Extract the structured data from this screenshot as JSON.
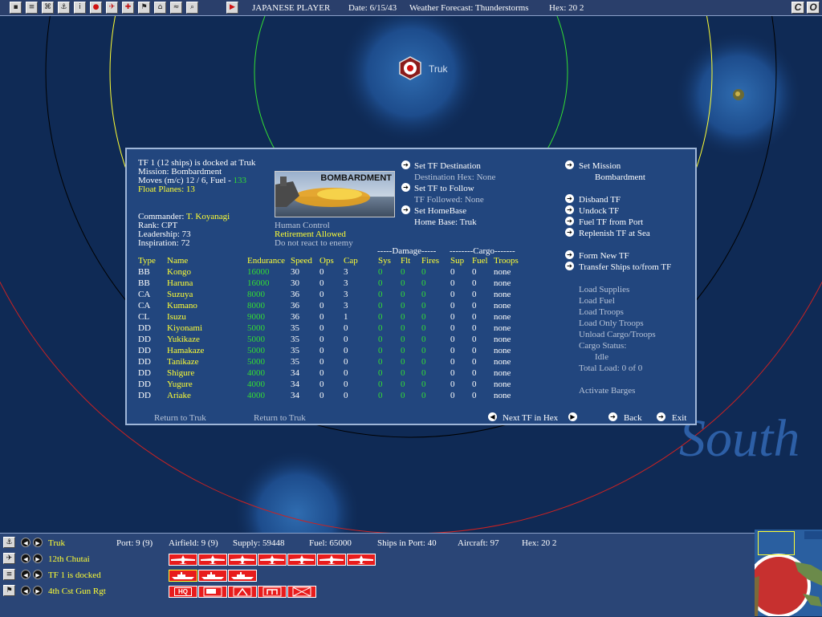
{
  "toolbar": {
    "player": "JAPANESE PLAYER",
    "date": "Date:  6/15/43",
    "weather": "Weather Forecast: Thunderstorms",
    "hex": "Hex: 20 2",
    "btn_c": "C",
    "btn_o": "O"
  },
  "map": {
    "base_label": "Truk",
    "region_label": "South"
  },
  "tf": {
    "header": "TF 1 (12 ships) is docked at Truk",
    "mission": "Mission:  Bombardment",
    "moves_prefix": "Moves (m/c)  12 / 6, Fuel - ",
    "fuel": "133",
    "float_planes": "Float Planes: 13",
    "commander_label": "Commander: ",
    "commander": "T. Koyanagi",
    "rank": "Rank: CPT",
    "leadership": "Leadership: 73",
    "inspiration": "Inspiration: 72",
    "picture_label": "BOMBARDMENT",
    "control": "Human Control",
    "retirement": "Retirement Allowed",
    "react": "Do not react to enemy"
  },
  "actions_mid": {
    "set_destination": "Set TF Destination",
    "destination_hex": "Destination Hex: None",
    "set_follow": "Set TF to Follow",
    "followed": "TF Followed: None",
    "set_homebase": "Set HomeBase",
    "home_base": "Home Base: Truk"
  },
  "actions_right": {
    "set_mission": "Set Mission",
    "mission_value": "Bombardment",
    "disband": "Disband TF",
    "undock": "Undock TF",
    "fuel_port": "Fuel TF from Port",
    "replenish": "Replenish TF at Sea",
    "form_new": "Form New TF",
    "transfer": "Transfer Ships to/from TF",
    "load_supplies": "Load Supplies",
    "load_fuel": "Load Fuel",
    "load_troops": "Load Troops",
    "load_only_troops": "Load Only Troops",
    "unload": "Unload Cargo/Troops",
    "cargo_status": "Cargo Status:",
    "cargo_status_value": "Idle",
    "total_load": "Total Load: 0 of 0",
    "activate_barges": "Activate Barges"
  },
  "table": {
    "group_damage": "-----Damage-----",
    "group_cargo": "--------Cargo-------",
    "headers": [
      "Type",
      "Name",
      "Endurance",
      "Speed",
      "Ops",
      "Cap",
      "Sys",
      "Flt",
      "Fires",
      "Sup",
      "Fuel",
      "Troops"
    ],
    "rows": [
      [
        "BB",
        "Kongo",
        "16000",
        "30",
        "0",
        "3",
        "0",
        "0",
        "0",
        "0",
        "0",
        "none"
      ],
      [
        "BB",
        "Haruna",
        "16000",
        "30",
        "0",
        "3",
        "0",
        "0",
        "0",
        "0",
        "0",
        "none"
      ],
      [
        "CA",
        "Suzuya",
        "8000",
        "36",
        "0",
        "3",
        "0",
        "0",
        "0",
        "0",
        "0",
        "none"
      ],
      [
        "CA",
        "Kumano",
        "8000",
        "36",
        "0",
        "3",
        "0",
        "0",
        "0",
        "0",
        "0",
        "none"
      ],
      [
        "CL",
        "Isuzu",
        "9000",
        "36",
        "0",
        "1",
        "0",
        "0",
        "0",
        "0",
        "0",
        "none"
      ],
      [
        "DD",
        "Kiyonami",
        "5000",
        "35",
        "0",
        "0",
        "0",
        "0",
        "0",
        "0",
        "0",
        "none"
      ],
      [
        "DD",
        "Yukikaze",
        "5000",
        "35",
        "0",
        "0",
        "0",
        "0",
        "0",
        "0",
        "0",
        "none"
      ],
      [
        "DD",
        "Hamakaze",
        "5000",
        "35",
        "0",
        "0",
        "0",
        "0",
        "0",
        "0",
        "0",
        "none"
      ],
      [
        "DD",
        "Tanikaze",
        "5000",
        "35",
        "0",
        "0",
        "0",
        "0",
        "0",
        "0",
        "0",
        "none"
      ],
      [
        "DD",
        "Shigure",
        "4000",
        "34",
        "0",
        "0",
        "0",
        "0",
        "0",
        "0",
        "0",
        "none"
      ],
      [
        "DD",
        "Yugure",
        "4000",
        "34",
        "0",
        "0",
        "0",
        "0",
        "0",
        "0",
        "0",
        "none"
      ],
      [
        "DD",
        "Ariake",
        "4000",
        "34",
        "0",
        "0",
        "0",
        "0",
        "0",
        "0",
        "0",
        "none"
      ]
    ]
  },
  "panel_footer": {
    "return1": "Return to Truk",
    "return2": "Return to Truk",
    "next_tf": "Next TF in Hex",
    "back": "Back",
    "exit": "Exit"
  },
  "bottom": {
    "base": "Truk",
    "port": "Port: 9 (9)",
    "airfield": "Airfield: 9 (9)",
    "supply": "Supply: 59448",
    "fuel": "Fuel: 65000",
    "ships_in_port": "Ships in Port: 40",
    "aircraft": "Aircraft: 97",
    "hex": "Hex: 20 2",
    "air_unit": "12th Chutai",
    "tf_status": "TF 1 is docked",
    "ground_unit": "4th Cst Gun Rgt",
    "ground_labels": [
      "HQ",
      "",
      "",
      "",
      ""
    ]
  }
}
